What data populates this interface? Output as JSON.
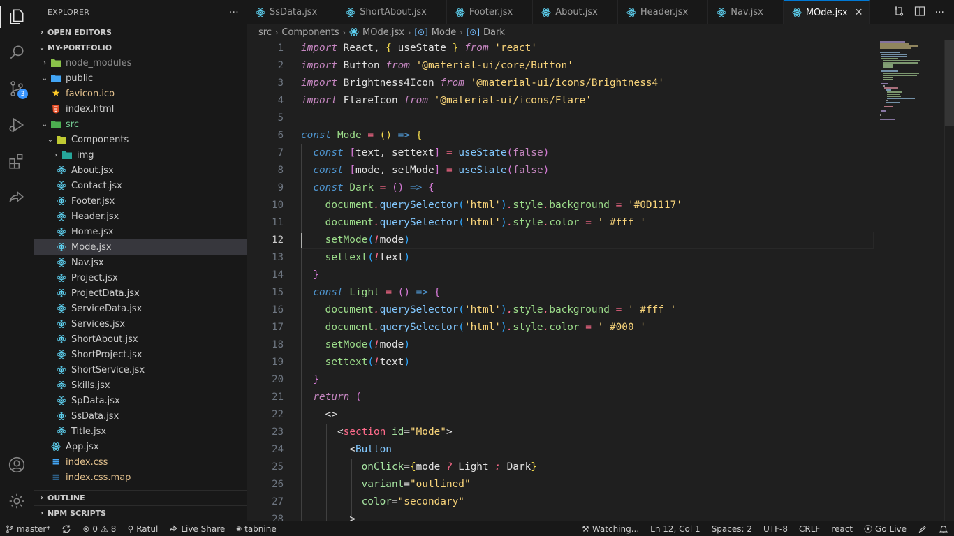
{
  "activity_bar": {
    "items": [
      "explorer-icon",
      "search-icon",
      "source-control-icon",
      "run-debug-icon",
      "extensions-icon",
      "live-share-icon"
    ],
    "source_control_badge": "3",
    "bottom": [
      "accounts-icon",
      "settings-gear-icon"
    ]
  },
  "sidebar": {
    "title": "EXPLORER",
    "more_label": "···",
    "open_editors": "OPEN EDITORS",
    "project": "MY-PORTFOLIO",
    "tree": [
      {
        "label": "node_modules",
        "indent": 1,
        "chev": "›",
        "icon": "folder-node-icon",
        "cls": "dim"
      },
      {
        "label": "public",
        "indent": 1,
        "chev": "⌄",
        "icon": "folder-public-icon",
        "cls": ""
      },
      {
        "label": "favicon.ico",
        "indent": 2,
        "chev": "",
        "icon": "star-icon",
        "cls": "yellow"
      },
      {
        "label": "index.html",
        "indent": 2,
        "chev": "",
        "icon": "html-icon",
        "cls": ""
      },
      {
        "label": "src",
        "indent": 1,
        "chev": "⌄",
        "icon": "folder-src-icon",
        "cls": "green"
      },
      {
        "label": "Components",
        "indent": 2,
        "chev": "⌄",
        "icon": "folder-components-icon",
        "cls": ""
      },
      {
        "label": "img",
        "indent": 3,
        "chev": "›",
        "icon": "folder-img-icon",
        "cls": ""
      },
      {
        "label": "About.jsx",
        "indent": 3,
        "chev": "",
        "icon": "react-icon",
        "cls": ""
      },
      {
        "label": "Contact.jsx",
        "indent": 3,
        "chev": "",
        "icon": "react-icon",
        "cls": ""
      },
      {
        "label": "Footer.jsx",
        "indent": 3,
        "chev": "",
        "icon": "react-icon",
        "cls": ""
      },
      {
        "label": "Header.jsx",
        "indent": 3,
        "chev": "",
        "icon": "react-icon",
        "cls": ""
      },
      {
        "label": "Home.jsx",
        "indent": 3,
        "chev": "",
        "icon": "react-icon",
        "cls": ""
      },
      {
        "label": "Mode.jsx",
        "indent": 3,
        "chev": "",
        "icon": "react-icon",
        "cls": "",
        "selected": true
      },
      {
        "label": "Nav.jsx",
        "indent": 3,
        "chev": "",
        "icon": "react-icon",
        "cls": ""
      },
      {
        "label": "Project.jsx",
        "indent": 3,
        "chev": "",
        "icon": "react-icon",
        "cls": ""
      },
      {
        "label": "ProjectData.jsx",
        "indent": 3,
        "chev": "",
        "icon": "react-icon",
        "cls": ""
      },
      {
        "label": "ServiceData.jsx",
        "indent": 3,
        "chev": "",
        "icon": "react-icon",
        "cls": ""
      },
      {
        "label": "Services.jsx",
        "indent": 3,
        "chev": "",
        "icon": "react-icon",
        "cls": ""
      },
      {
        "label": "ShortAbout.jsx",
        "indent": 3,
        "chev": "",
        "icon": "react-icon",
        "cls": ""
      },
      {
        "label": "ShortProject.jsx",
        "indent": 3,
        "chev": "",
        "icon": "react-icon",
        "cls": ""
      },
      {
        "label": "ShortService.jsx",
        "indent": 3,
        "chev": "",
        "icon": "react-icon",
        "cls": ""
      },
      {
        "label": "Skills.jsx",
        "indent": 3,
        "chev": "",
        "icon": "react-icon",
        "cls": ""
      },
      {
        "label": "SpData.jsx",
        "indent": 3,
        "chev": "",
        "icon": "react-icon",
        "cls": ""
      },
      {
        "label": "SsData.jsx",
        "indent": 3,
        "chev": "",
        "icon": "react-icon",
        "cls": ""
      },
      {
        "label": "Title.jsx",
        "indent": 3,
        "chev": "",
        "icon": "react-icon",
        "cls": ""
      },
      {
        "label": "App.jsx",
        "indent": 2,
        "chev": "",
        "icon": "react-icon",
        "cls": ""
      },
      {
        "label": "index.css",
        "indent": 2,
        "chev": "",
        "icon": "css-icon",
        "cls": "yellow"
      },
      {
        "label": "index.css.map",
        "indent": 2,
        "chev": "",
        "icon": "css-icon",
        "cls": "yellow"
      }
    ],
    "outline": "OUTLINE",
    "npm_scripts": "NPM SCRIPTS"
  },
  "tabs": [
    {
      "label": "SsData.jsx",
      "active": false
    },
    {
      "label": "ShortAbout.jsx",
      "active": false
    },
    {
      "label": "Footer.jsx",
      "active": false
    },
    {
      "label": "About.jsx",
      "active": false
    },
    {
      "label": "Header.jsx",
      "active": false
    },
    {
      "label": "Nav.jsx",
      "active": false
    },
    {
      "label": "MOde.jsx",
      "active": true
    }
  ],
  "tab_close": "✕",
  "breadcrumb": {
    "parts": [
      "src",
      "Components",
      "MOde.jsx",
      "Mode",
      "Dark"
    ]
  },
  "editor": {
    "current_line": 12,
    "lines": [
      [
        [
          "kw",
          "import"
        ],
        [
          "id",
          " React, "
        ],
        [
          "br",
          "{"
        ],
        [
          "id",
          " useState "
        ],
        [
          "br",
          "}"
        ],
        [
          "id",
          " "
        ],
        [
          "kw",
          "from"
        ],
        [
          "id",
          " "
        ],
        [
          "str",
          "'react'"
        ]
      ],
      [
        [
          "kw",
          "import"
        ],
        [
          "id",
          " Button "
        ],
        [
          "kw",
          "from"
        ],
        [
          "id",
          " "
        ],
        [
          "str",
          "'@material-ui/core/Button'"
        ]
      ],
      [
        [
          "kw",
          "import"
        ],
        [
          "id",
          " Brightness4Icon "
        ],
        [
          "kw",
          "from"
        ],
        [
          "id",
          " "
        ],
        [
          "str",
          "'@material-ui/icons/Brightness4'"
        ]
      ],
      [
        [
          "kw",
          "import"
        ],
        [
          "id",
          " FlareIcon "
        ],
        [
          "kw",
          "from"
        ],
        [
          "id",
          " "
        ],
        [
          "str",
          "'@material-ui/icons/Flare'"
        ]
      ],
      [],
      [
        [
          "kw2",
          "const"
        ],
        [
          "id",
          " "
        ],
        [
          "var",
          "Mode"
        ],
        [
          "id",
          " "
        ],
        [
          "op",
          "="
        ],
        [
          "id",
          " "
        ],
        [
          "br",
          "()"
        ],
        [
          "id",
          " "
        ],
        [
          "kw2",
          "=>"
        ],
        [
          "id",
          " "
        ],
        [
          "br",
          "{"
        ]
      ],
      [
        [
          "id",
          "  "
        ],
        [
          "kw2",
          "const"
        ],
        [
          "id",
          " "
        ],
        [
          "br2",
          "["
        ],
        [
          "id",
          "text, settext"
        ],
        [
          "br2",
          "]"
        ],
        [
          "id",
          " "
        ],
        [
          "op",
          "="
        ],
        [
          "id",
          " "
        ],
        [
          "fn",
          "useState"
        ],
        [
          "br2",
          "("
        ],
        [
          "bool",
          "false"
        ],
        [
          "br2",
          ")"
        ]
      ],
      [
        [
          "id",
          "  "
        ],
        [
          "kw2",
          "const"
        ],
        [
          "id",
          " "
        ],
        [
          "br2",
          "["
        ],
        [
          "id",
          "mode, setMode"
        ],
        [
          "br2",
          "]"
        ],
        [
          "id",
          " "
        ],
        [
          "op",
          "="
        ],
        [
          "id",
          " "
        ],
        [
          "fn",
          "useState"
        ],
        [
          "br2",
          "("
        ],
        [
          "bool",
          "false"
        ],
        [
          "br2",
          ")"
        ]
      ],
      [
        [
          "id",
          "  "
        ],
        [
          "kw2",
          "const"
        ],
        [
          "id",
          " "
        ],
        [
          "var",
          "Dark"
        ],
        [
          "id",
          " "
        ],
        [
          "op",
          "="
        ],
        [
          "id",
          " "
        ],
        [
          "br2",
          "()"
        ],
        [
          "id",
          " "
        ],
        [
          "kw2",
          "=>"
        ],
        [
          "id",
          " "
        ],
        [
          "br2",
          "{"
        ]
      ],
      [
        [
          "id",
          "    "
        ],
        [
          "var",
          "document"
        ],
        [
          "op",
          "."
        ],
        [
          "fn",
          "querySelector"
        ],
        [
          "br3",
          "("
        ],
        [
          "str",
          "'html'"
        ],
        [
          "br3",
          ")"
        ],
        [
          "op",
          "."
        ],
        [
          "var",
          "style"
        ],
        [
          "op",
          "."
        ],
        [
          "var",
          "background"
        ],
        [
          "id",
          " "
        ],
        [
          "op",
          "="
        ],
        [
          "id",
          " "
        ],
        [
          "str",
          "'#0D1117'"
        ]
      ],
      [
        [
          "id",
          "    "
        ],
        [
          "var",
          "document"
        ],
        [
          "op",
          "."
        ],
        [
          "fn",
          "querySelector"
        ],
        [
          "br3",
          "("
        ],
        [
          "str",
          "'html'"
        ],
        [
          "br3",
          ")"
        ],
        [
          "op",
          "."
        ],
        [
          "var",
          "style"
        ],
        [
          "op",
          "."
        ],
        [
          "var",
          "color"
        ],
        [
          "id",
          " "
        ],
        [
          "op",
          "="
        ],
        [
          "id",
          " "
        ],
        [
          "str",
          "' #fff '"
        ]
      ],
      [
        [
          "id",
          "    "
        ],
        [
          "var",
          "setMode"
        ],
        [
          "br3",
          "("
        ],
        [
          "op",
          "!"
        ],
        [
          "id",
          "mode"
        ],
        [
          "br3",
          ")"
        ]
      ],
      [
        [
          "id",
          "    "
        ],
        [
          "var",
          "settext"
        ],
        [
          "br3",
          "("
        ],
        [
          "op",
          "!"
        ],
        [
          "id",
          "text"
        ],
        [
          "br3",
          ")"
        ]
      ],
      [
        [
          "id",
          "  "
        ],
        [
          "br2",
          "}"
        ]
      ],
      [
        [
          "id",
          "  "
        ],
        [
          "kw2",
          "const"
        ],
        [
          "id",
          " "
        ],
        [
          "var",
          "Light"
        ],
        [
          "id",
          " "
        ],
        [
          "op",
          "="
        ],
        [
          "id",
          " "
        ],
        [
          "br2",
          "()"
        ],
        [
          "id",
          " "
        ],
        [
          "kw2",
          "=>"
        ],
        [
          "id",
          " "
        ],
        [
          "br2",
          "{"
        ]
      ],
      [
        [
          "id",
          "    "
        ],
        [
          "var",
          "document"
        ],
        [
          "op",
          "."
        ],
        [
          "fn",
          "querySelector"
        ],
        [
          "br3",
          "("
        ],
        [
          "str",
          "'html'"
        ],
        [
          "br3",
          ")"
        ],
        [
          "op",
          "."
        ],
        [
          "var",
          "style"
        ],
        [
          "op",
          "."
        ],
        [
          "var",
          "background"
        ],
        [
          "id",
          " "
        ],
        [
          "op",
          "="
        ],
        [
          "id",
          " "
        ],
        [
          "str",
          "' #fff '"
        ]
      ],
      [
        [
          "id",
          "    "
        ],
        [
          "var",
          "document"
        ],
        [
          "op",
          "."
        ],
        [
          "fn",
          "querySelector"
        ],
        [
          "br3",
          "("
        ],
        [
          "str",
          "'html'"
        ],
        [
          "br3",
          ")"
        ],
        [
          "op",
          "."
        ],
        [
          "var",
          "style"
        ],
        [
          "op",
          "."
        ],
        [
          "var",
          "color"
        ],
        [
          "id",
          " "
        ],
        [
          "op",
          "="
        ],
        [
          "id",
          " "
        ],
        [
          "str",
          "' #000 '"
        ]
      ],
      [
        [
          "id",
          "    "
        ],
        [
          "var",
          "setMode"
        ],
        [
          "br3",
          "("
        ],
        [
          "op",
          "!"
        ],
        [
          "id",
          "mode"
        ],
        [
          "br3",
          ")"
        ]
      ],
      [
        [
          "id",
          "    "
        ],
        [
          "var",
          "settext"
        ],
        [
          "br3",
          "("
        ],
        [
          "op",
          "!"
        ],
        [
          "id",
          "text"
        ],
        [
          "br3",
          ")"
        ]
      ],
      [
        [
          "id",
          "  "
        ],
        [
          "br2",
          "}"
        ]
      ],
      [
        [
          "id",
          "  "
        ],
        [
          "kw",
          "return"
        ],
        [
          "id",
          " "
        ],
        [
          "br2",
          "("
        ]
      ],
      [
        [
          "id",
          "    "
        ],
        [
          "id",
          "<>"
        ]
      ],
      [
        [
          "id",
          "      "
        ],
        [
          "id",
          "<"
        ],
        [
          "tag",
          "section"
        ],
        [
          "id",
          " "
        ],
        [
          "attr",
          "id"
        ],
        [
          "id",
          "="
        ],
        [
          "str",
          "\"Mode\""
        ],
        [
          "id",
          ">"
        ]
      ],
      [
        [
          "id",
          "        "
        ],
        [
          "id",
          "<"
        ],
        [
          "fn",
          "Button"
        ]
      ],
      [
        [
          "id",
          "          "
        ],
        [
          "attr",
          "onClick"
        ],
        [
          "id",
          "="
        ],
        [
          "br",
          "{"
        ],
        [
          "id",
          "mode "
        ],
        [
          "op",
          "?"
        ],
        [
          "id",
          " Light "
        ],
        [
          "op",
          ":"
        ],
        [
          "id",
          " Dark"
        ],
        [
          "br",
          "}"
        ]
      ],
      [
        [
          "id",
          "          "
        ],
        [
          "attr",
          "variant"
        ],
        [
          "id",
          "="
        ],
        [
          "str",
          "\"outlined\""
        ]
      ],
      [
        [
          "id",
          "          "
        ],
        [
          "attr",
          "color"
        ],
        [
          "id",
          "="
        ],
        [
          "str",
          "\"secondary\""
        ]
      ],
      [
        [
          "id",
          "        "
        ],
        [
          "id",
          ">"
        ]
      ]
    ]
  },
  "status": {
    "branch": "master*",
    "errors": "0",
    "warnings": "8",
    "user": "Ratul",
    "live_share": "Live Share",
    "tabnine": "tabnine",
    "watching": "Watching...",
    "position": "Ln 12, Col 1",
    "spaces": "Spaces: 2",
    "encoding": "UTF-8",
    "eol": "CRLF",
    "language": "react",
    "go_live": "Go Live"
  }
}
